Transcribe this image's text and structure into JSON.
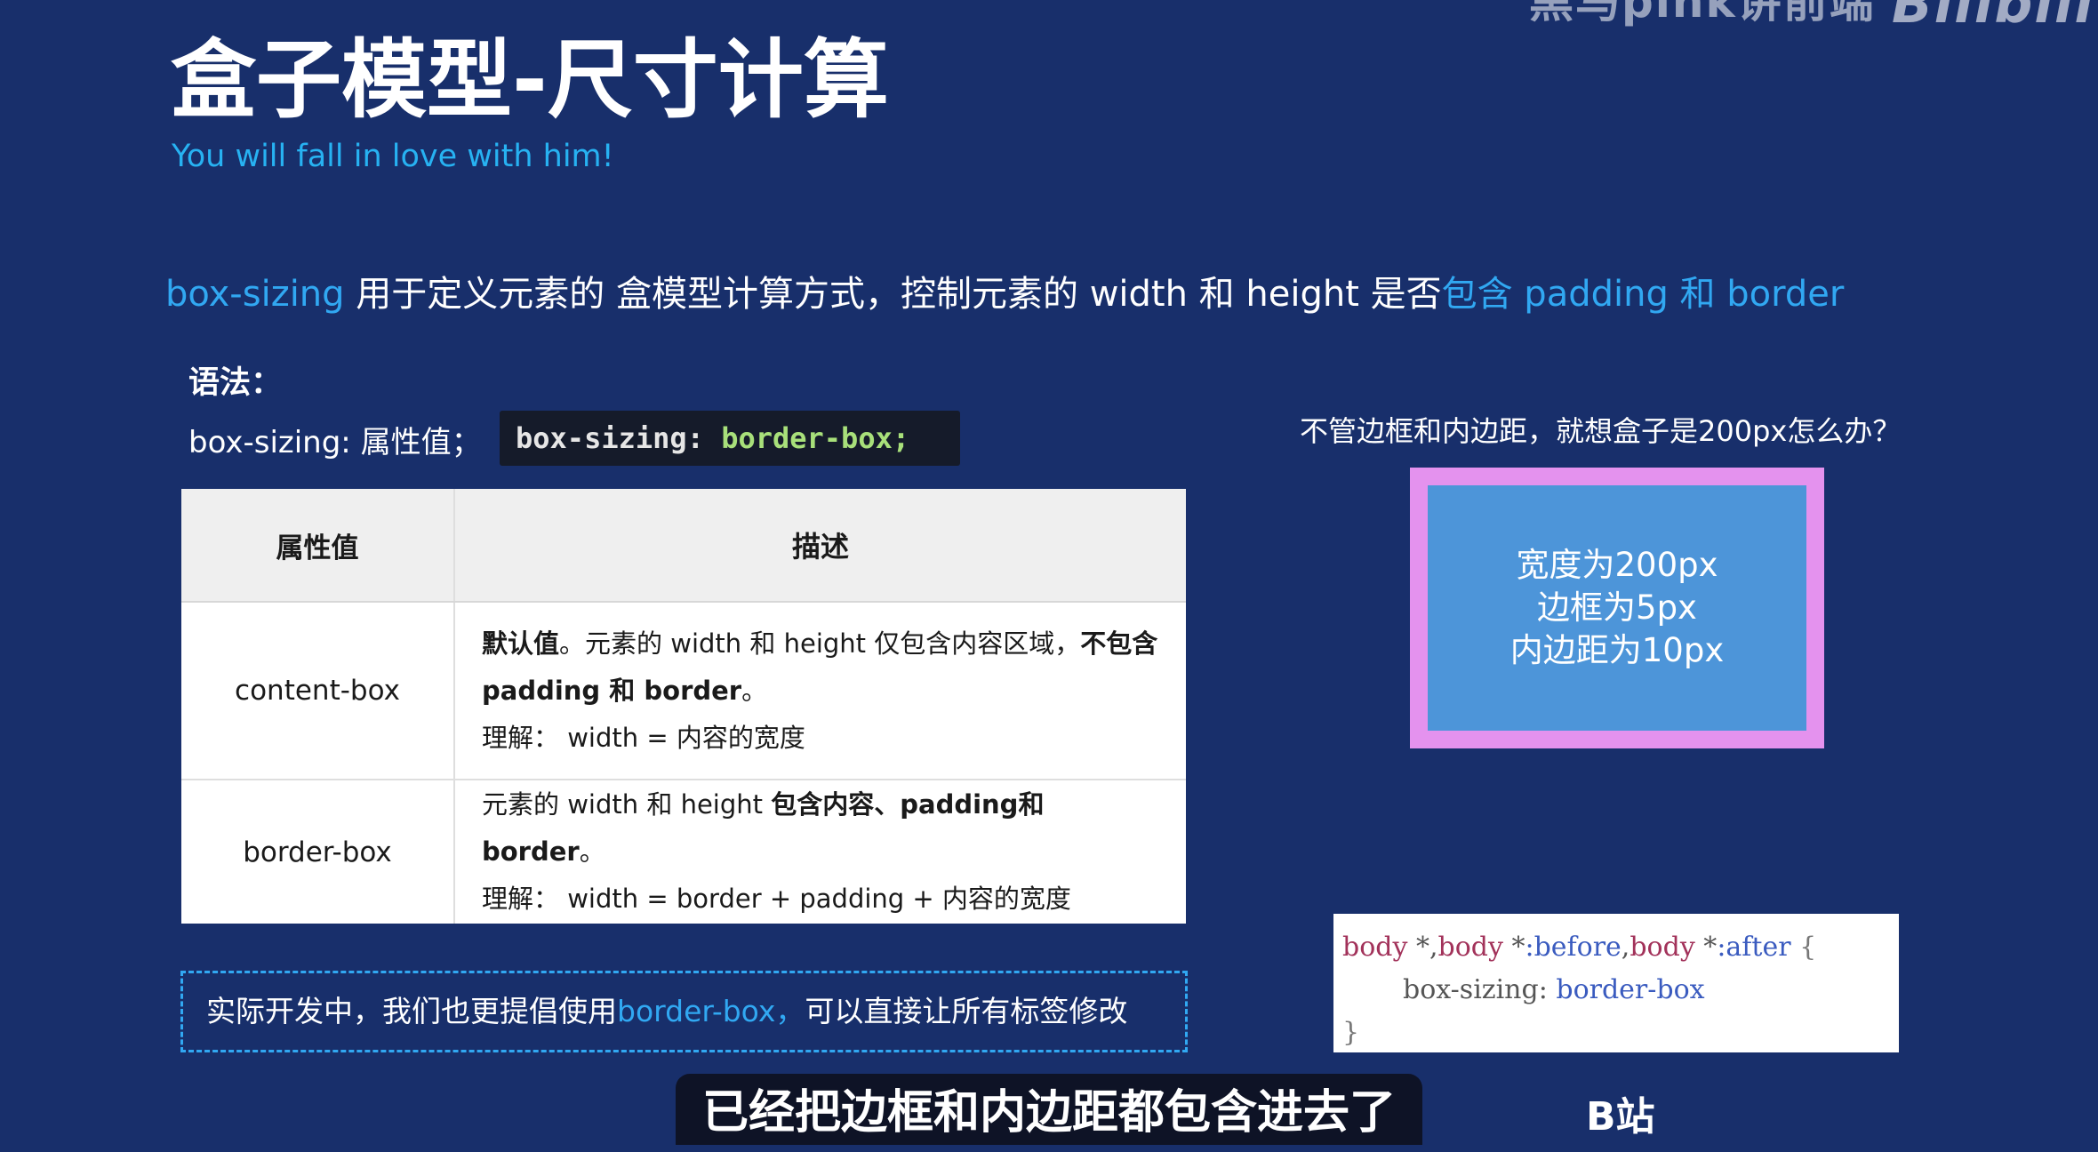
{
  "watermark": {
    "text": "黑马pink讲前端",
    "logo": "Bilibili"
  },
  "title": "盒子模型-尺寸计算",
  "subtitle": "You will fall in love with him!",
  "intro": {
    "part1": "box-sizing",
    "part2": " 用于定义元素的 盒模型计算方式，控制元素的 width 和 height 是否",
    "part3": "包含 padding 和 border"
  },
  "syntax": {
    "label": "语法：",
    "line": "box-sizing: 属性值；",
    "code_prop": "box-sizing:",
    "code_value": " border-box;"
  },
  "table": {
    "headers": [
      "属性值",
      "描述"
    ],
    "rows": [
      {
        "value": "content-box",
        "desc_bold1": "默认值",
        "desc_text1": "。元素的 width 和 height 仅包含内容区域，",
        "desc_bold2": "不包含 padding 和 border",
        "desc_text2": "。",
        "understand": "理解： width = 内容的宽度"
      },
      {
        "value": "border-box",
        "desc_text1": "元素的 width 和 height ",
        "desc_bold1": "包含内容、padding和 border",
        "desc_text2": "。",
        "understand": "理解： width = border + padding + 内容的宽度"
      }
    ]
  },
  "note": {
    "text1": "实际开发中，我们也更提倡使用",
    "highlight": "border-box，",
    "text2": "可以直接让所有标签修改"
  },
  "question": "不管边框和内边距，就想盒子是200px怎么办？",
  "box_demo": {
    "line1": "宽度为200px",
    "line2": "边框为5px",
    "line3": "内边距为10px",
    "outer_color": "#e492ee",
    "inner_color": "#4d95d9"
  },
  "code_snippet": {
    "body": "body",
    "star_comma": " *,",
    "star": " *",
    "before": ":before",
    "after": ":after",
    "brace_open": " {",
    "prop": "box-sizing:",
    "value": " border-box",
    "brace_close": "}"
  },
  "caption": "已经把边框和内边距都包含进去了",
  "bsite": "B站",
  "colors": {
    "background": "#182f6b",
    "accent": "#31a8f2"
  }
}
